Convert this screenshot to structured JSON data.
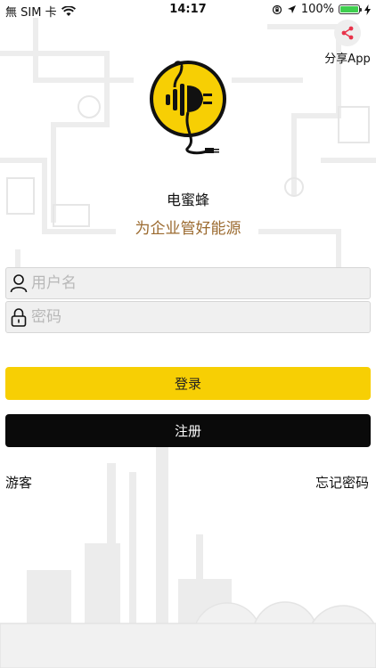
{
  "status_bar": {
    "carrier": "無 SIM 卡",
    "time": "14:17",
    "battery": "100%"
  },
  "share": {
    "label": "分享App",
    "icon": "share-icon"
  },
  "app": {
    "name": "电蜜蜂",
    "slogan": "为企业管好能源",
    "logo": "bee-plug-logo"
  },
  "login_form": {
    "username_placeholder": "用户名",
    "password_placeholder": "密码",
    "login_label": "登录",
    "register_label": "注册"
  },
  "links": {
    "guest": "游客",
    "forgot_password": "忘记密码"
  },
  "colors": {
    "accent_yellow": "#f7cf04",
    "slogan_brown": "#9b6a2f",
    "register_black": "#0a0a0a",
    "share_red": "#e8334a"
  }
}
